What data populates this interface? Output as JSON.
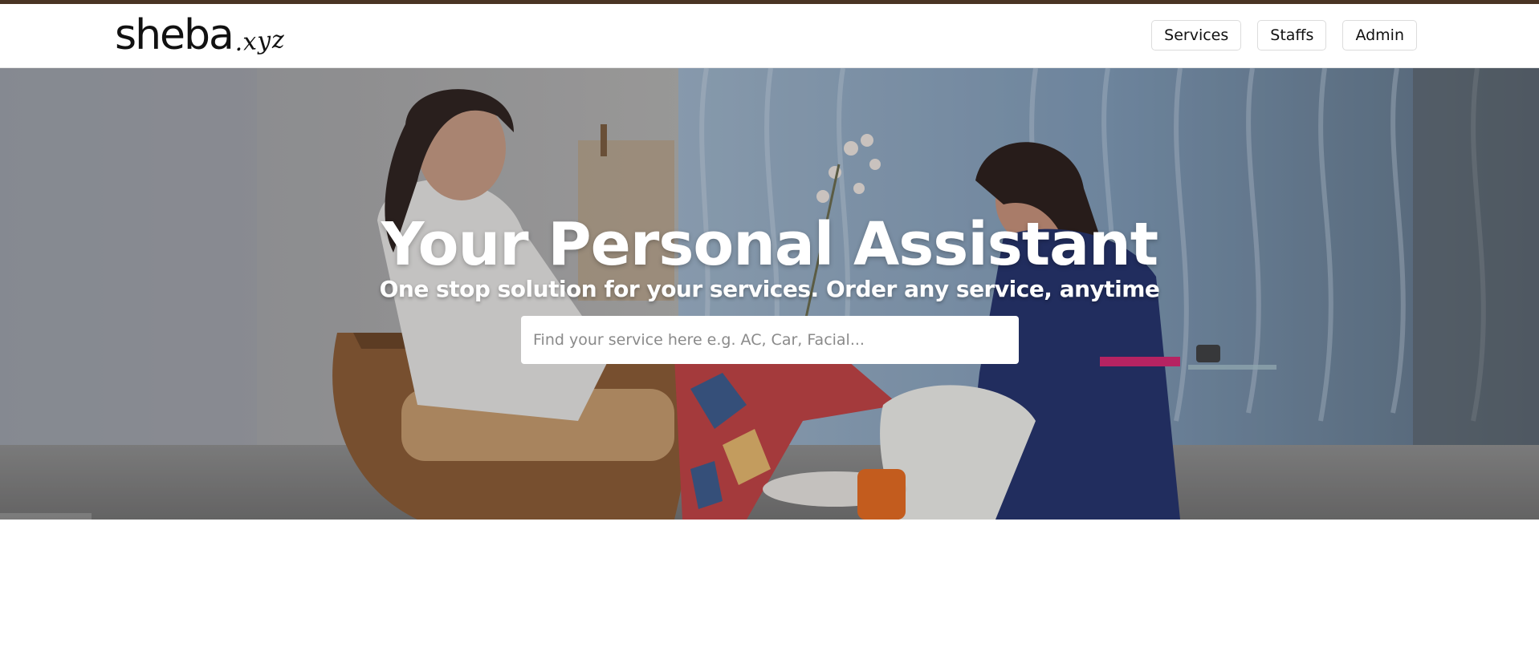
{
  "brand": {
    "name": "sheba",
    "tld": ".xyz"
  },
  "nav": {
    "items": [
      {
        "label": "Services"
      },
      {
        "label": "Staffs"
      },
      {
        "label": "Admin"
      }
    ]
  },
  "hero": {
    "title": "Your Personal Assistant",
    "subtitle": "One stop solution for your services. Order any service, anytime",
    "search_placeholder": "Find your service here e.g. AC, Car, Facial...",
    "search_value": ""
  },
  "colors": {
    "top_strip": "#4a3424",
    "navbar_bg": "#ffffff",
    "hero_text": "#ffffff"
  }
}
